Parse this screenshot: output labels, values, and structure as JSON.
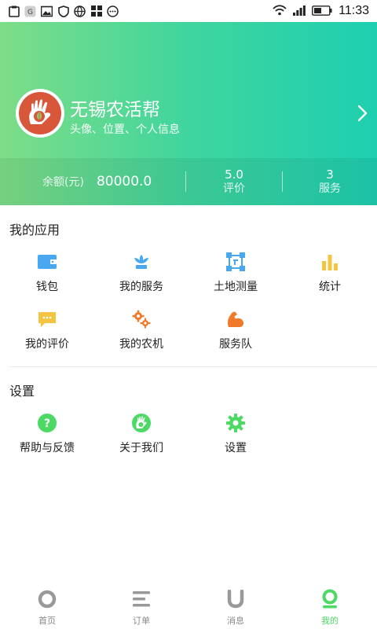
{
  "status_bar": {
    "time": "11:33",
    "left_icons": [
      "clipboard-icon",
      "app-icon",
      "image-icon",
      "shield-icon",
      "globe-icon",
      "grid-icon",
      "more-icon"
    ],
    "right_icons": [
      "wifi-icon",
      "signal-icon",
      "battery-icon"
    ]
  },
  "profile": {
    "name": "无锡农活帮",
    "subtitle": "头像、位置、个人信息"
  },
  "stats": {
    "balance_label": "余额(元)",
    "balance_value": "80000.0",
    "rating_value": "5.0",
    "rating_label": "评价",
    "services_value": "3",
    "services_label": "服务"
  },
  "my_apps": {
    "title": "我的应用",
    "items": [
      {
        "label": "钱包",
        "icon": "wallet-icon",
        "color": "#4aa8f0"
      },
      {
        "label": "我的服务",
        "icon": "lotus-icon",
        "color": "#4aa8f0"
      },
      {
        "label": "土地测量",
        "icon": "measure-frame-icon",
        "color": "#4aa8f0"
      },
      {
        "label": "统计",
        "icon": "bar-chart-icon",
        "color": "#f5c542"
      },
      {
        "label": "我的评价",
        "icon": "comment-icon",
        "color": "#f5c542"
      },
      {
        "label": "我的农机",
        "icon": "gears-icon",
        "color": "#f07a2a"
      },
      {
        "label": "服务队",
        "icon": "muscle-arm-icon",
        "color": "#f07a2a"
      }
    ]
  },
  "settings": {
    "title": "设置",
    "items": [
      {
        "label": "帮助与反馈",
        "icon": "question-icon",
        "color": "#4cd964"
      },
      {
        "label": "关于我们",
        "icon": "hand-leaf-icon",
        "color": "#4cd964"
      },
      {
        "label": "设置",
        "icon": "gear-icon",
        "color": "#4cd964"
      }
    ]
  },
  "bottom_nav": [
    {
      "label": "首页",
      "icon": "home-circle-icon",
      "active": false
    },
    {
      "label": "订单",
      "icon": "list-icon",
      "active": false
    },
    {
      "label": "消息",
      "icon": "u-shape-icon",
      "active": false
    },
    {
      "label": "我的",
      "icon": "user-pin-icon",
      "active": true
    }
  ],
  "colors": {
    "header_gradient_start": "#7edd87",
    "header_gradient_end": "#1ecfb0",
    "active_nav": "#4cd964",
    "inactive_nav": "#999999"
  }
}
